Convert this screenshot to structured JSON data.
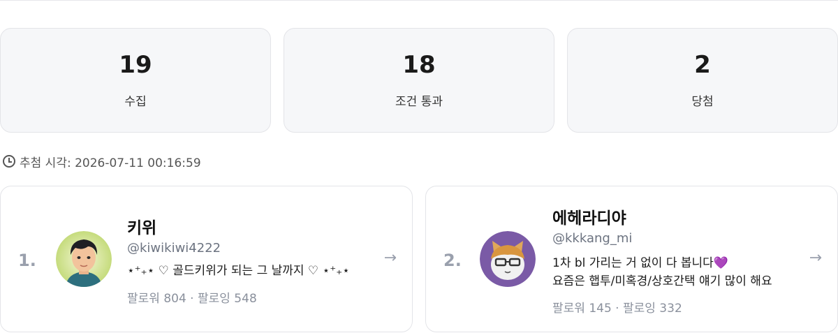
{
  "stats": [
    {
      "value": "19",
      "label": "수집"
    },
    {
      "value": "18",
      "label": "조건 통과"
    },
    {
      "value": "2",
      "label": "당첨"
    }
  ],
  "draw_time": {
    "icon": "clock-icon",
    "text": "추첨 시각: 2026-07-11 00:16:59"
  },
  "winners": [
    {
      "rank": "1.",
      "name": "키위",
      "handle": "@kiwikiwi4222",
      "bio_line1": "⋆⁺₊⋆ ♡ 골드키위가 되는 그 날까지 ♡ ⋆⁺₊⋆",
      "bio_line2": "",
      "follow": "팔로워 804 · 팔로잉 548",
      "arrow": "→"
    },
    {
      "rank": "2.",
      "name": "에헤라디야",
      "handle": "@kkkang_mi",
      "bio_line1": "1차 bl 가리는 거 없이 다 봅니다💜",
      "bio_line2": "요즘은 햅투/미혹경/상호간택 얘기 많이 해요",
      "follow": "팔로워 145 · 팔로잉 332",
      "arrow": "→"
    }
  ],
  "colors": {
    "card_bg": "#f6f7f9",
    "border": "#e3e4e8",
    "muted": "#8a909c",
    "rank": "#9aa0ad"
  }
}
